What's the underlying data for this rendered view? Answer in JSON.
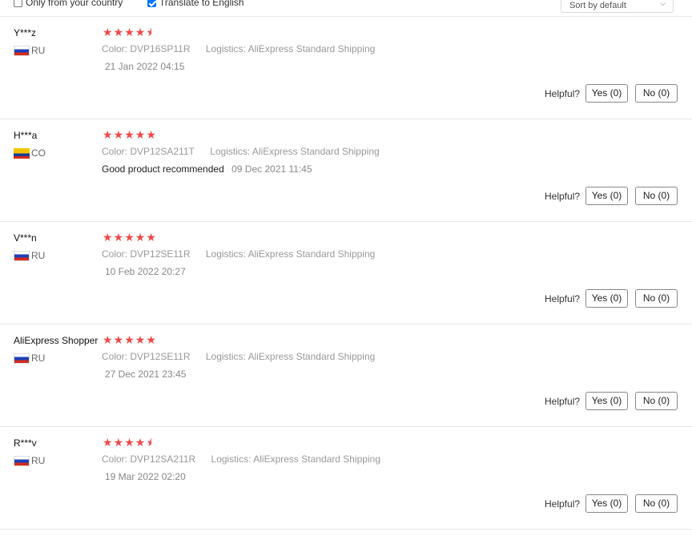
{
  "filters": {
    "only_country_label": "Only from your country",
    "only_country_checked": false,
    "translate_label": "Translate to English",
    "translate_checked": true
  },
  "sort": {
    "selected": "Sort by default"
  },
  "colors": {
    "star": "#f04848",
    "accent_checkbox": "#0075ff"
  },
  "reviews": [
    {
      "user": "Y***z",
      "country": "RU",
      "flag_icon": "russia-flag-icon",
      "rating": 4.5,
      "color_key": "Color:",
      "color_value": "DVP16SP11R",
      "logistics_key": "Logistics:",
      "logistics_value": "AliExpress Standard Shipping",
      "text": "",
      "date": "21 Jan 2022 04:15",
      "helpful_label": "Helpful?",
      "yes_label": "Yes (0)",
      "no_label": "No (0)"
    },
    {
      "user": "H***a",
      "country": "CO",
      "flag_icon": "colombia-flag-icon",
      "rating": 5,
      "color_key": "Color:",
      "color_value": "DVP12SA211T",
      "logistics_key": "Logistics:",
      "logistics_value": "AliExpress Standard Shipping",
      "text": "Good product recommended",
      "date": "09 Dec 2021 11:45",
      "helpful_label": "Helpful?",
      "yes_label": "Yes (0)",
      "no_label": "No (0)"
    },
    {
      "user": "V***n",
      "country": "RU",
      "flag_icon": "russia-flag-icon",
      "rating": 5,
      "color_key": "Color:",
      "color_value": "DVP12SE11R",
      "logistics_key": "Logistics:",
      "logistics_value": "AliExpress Standard Shipping",
      "text": "",
      "date": "10 Feb 2022 20:27",
      "helpful_label": "Helpful?",
      "yes_label": "Yes (0)",
      "no_label": "No (0)"
    },
    {
      "user": "AliExpress Shopper",
      "country": "RU",
      "flag_icon": "russia-flag-icon",
      "rating": 5,
      "color_key": "Color:",
      "color_value": "DVP12SE11R",
      "logistics_key": "Logistics:",
      "logistics_value": "AliExpress Standard Shipping",
      "text": "",
      "date": "27 Dec 2021 23:45",
      "helpful_label": "Helpful?",
      "yes_label": "Yes (0)",
      "no_label": "No (0)"
    },
    {
      "user": "R***v",
      "country": "RU",
      "flag_icon": "russia-flag-icon",
      "rating": 4.5,
      "color_key": "Color:",
      "color_value": "DVP12SA211R",
      "logistics_key": "Logistics:",
      "logistics_value": "AliExpress Standard Shipping",
      "text": "",
      "date": "19 Mar 2022 02:20",
      "helpful_label": "Helpful?",
      "yes_label": "Yes (0)",
      "no_label": "No (0)"
    }
  ]
}
